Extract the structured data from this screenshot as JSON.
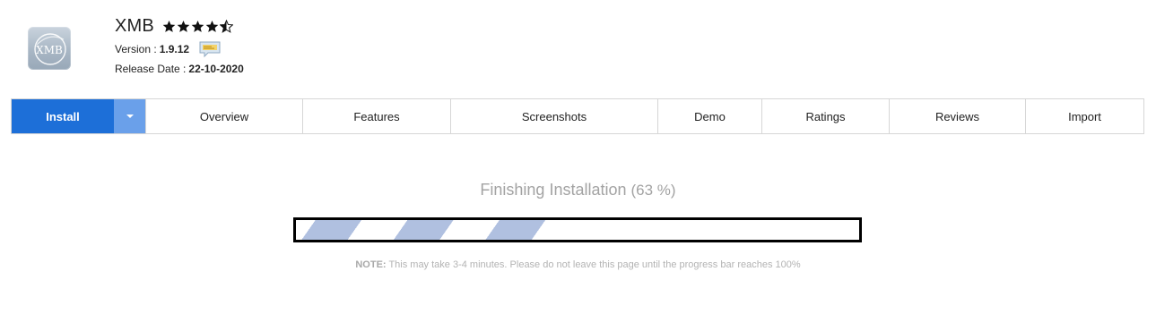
{
  "app": {
    "name": "XMB",
    "logo_text": "XMB",
    "rating": 4.5,
    "version_label": "Version :",
    "version": "1.9.12",
    "release_label": "Release Date :",
    "release_date": "22-10-2020",
    "icons": {
      "rating": "star-icon",
      "changelog": "changelog-speech-bubble-icon"
    }
  },
  "tabs": {
    "install": "Install",
    "overview": "Overview",
    "features": "Features",
    "screenshots": "Screenshots",
    "demo": "Demo",
    "ratings": "Ratings",
    "reviews": "Reviews",
    "import": "Import"
  },
  "progress": {
    "title": "Finishing Installation",
    "percent_text": "(63 %)",
    "percent": 0.5,
    "note_label": "NOTE:",
    "note_text": "This may take 3-4 minutes. Please do not leave this page until the progress bar reaches 100%"
  },
  "colors": {
    "install_tab": "#1d6fd8",
    "install_dropdown": "#6aa0ea",
    "progress_stripe": "#b0c0e0",
    "muted_text": "#a3a3a3"
  }
}
